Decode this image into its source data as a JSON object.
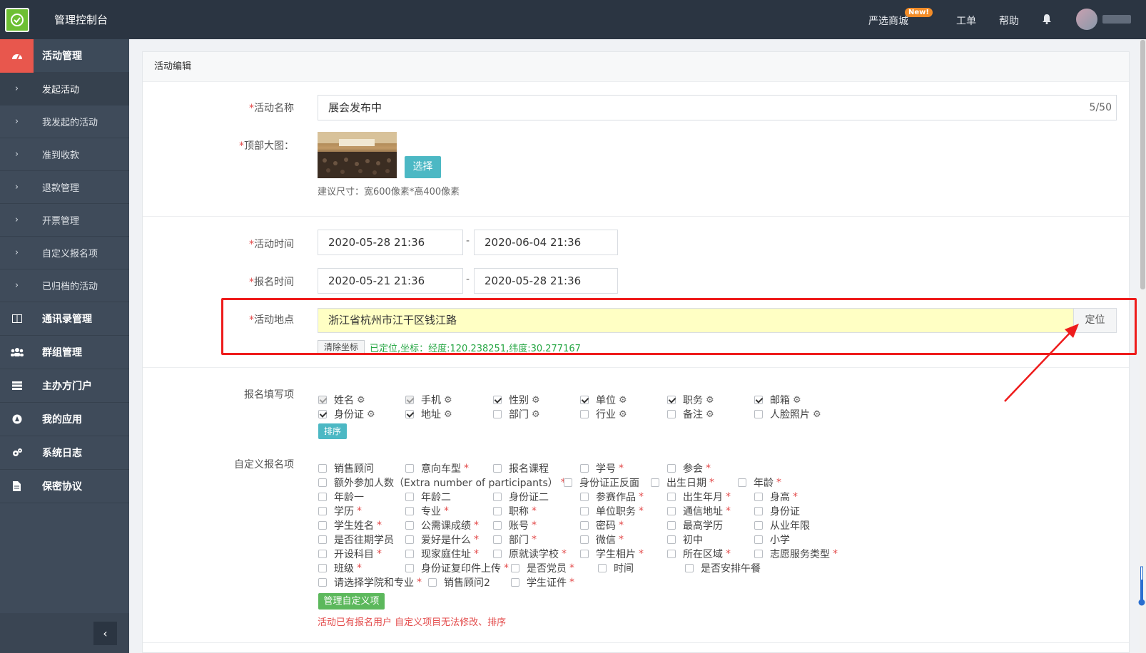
{
  "app": {
    "title": "管理控制台"
  },
  "topbar": {
    "links": [
      {
        "label": "严选商城"
      },
      {
        "label": "工单"
      },
      {
        "label": "帮助"
      }
    ],
    "new_badge": "New!"
  },
  "sidebar": {
    "sections": [
      {
        "label": "活动管理",
        "icon": "dashboard-icon",
        "active": true
      },
      {
        "label": "通讯录管理",
        "icon": "columns-icon"
      },
      {
        "label": "群组管理",
        "icon": "users-icon"
      },
      {
        "label": "主办方门户",
        "icon": "list-icon"
      },
      {
        "label": "我的应用",
        "icon": "app-icon"
      },
      {
        "label": "系统日志",
        "icon": "gears-icon"
      },
      {
        "label": "保密协议",
        "icon": "file-icon"
      }
    ],
    "sub_items": [
      {
        "label": "发起活动",
        "current": true
      },
      {
        "label": "我发起的活动"
      },
      {
        "label": "准到收款"
      },
      {
        "label": "退款管理"
      },
      {
        "label": "开票管理"
      },
      {
        "label": "自定义报名项"
      },
      {
        "label": "已归档的活动"
      }
    ],
    "collapse_label": "‹"
  },
  "panel": {
    "title": "活动编辑"
  },
  "form": {
    "name_label": "活动名称",
    "name_value": "展会发布中",
    "name_counter": "5/50",
    "image_label": "顶部大图：",
    "select_button": "选择",
    "image_hint": "建议尺寸：宽600像素*高400像素",
    "time_label": "活动时间",
    "time_start": "2020-05-28 21:36",
    "time_end": "2020-06-04 21:36",
    "signup_label": "报名时间",
    "signup_start": "2020-05-21 21:36",
    "signup_end": "2020-05-28 21:36",
    "dash": "-",
    "required_mark": "*",
    "location_label": "活动地点",
    "location_value": "浙江省杭州市江干区钱江路",
    "locate_button": "定位",
    "clear_button": "清除坐标",
    "located_text": "已定位,坐标：经度:120.238251,纬度:30.277167",
    "fields_label": "报名填写项",
    "sort_button": "排序",
    "custom_label": "自定义报名项",
    "manage_button": "管理自定义项",
    "warning": "活动已有报名用户 自定义项目无法修改、排序"
  },
  "signup_fields": [
    {
      "label": "姓名",
      "checked": true,
      "disabled": true
    },
    {
      "label": "手机",
      "checked": true,
      "disabled": true
    },
    {
      "label": "性别",
      "checked": true
    },
    {
      "label": "单位",
      "checked": true
    },
    {
      "label": "职务",
      "checked": true
    },
    {
      "label": "邮箱",
      "checked": true
    },
    {
      "label": "身份证",
      "checked": true
    },
    {
      "label": "地址",
      "checked": true
    },
    {
      "label": "部门",
      "checked": false
    },
    {
      "label": "行业",
      "checked": false
    },
    {
      "label": "备注",
      "checked": false
    },
    {
      "label": "人脸照片",
      "checked": false
    }
  ],
  "custom_fields": [
    [
      {
        "label": "销售顾问"
      },
      {
        "label": "意向车型",
        "req": true
      },
      {
        "label": "报名课程"
      },
      {
        "label": "学号",
        "req": true
      },
      {
        "label": "参会",
        "req": true
      }
    ],
    [
      {
        "label": "额外参加人数（Extra number of participants）",
        "req": true
      },
      {
        "label": "身份证正反面"
      },
      {
        "label": "出生日期",
        "req": true
      },
      {
        "label": "年龄",
        "req": true
      }
    ],
    [
      {
        "label": "年龄一"
      },
      {
        "label": "年龄二"
      },
      {
        "label": "身份证二"
      },
      {
        "label": "参赛作品",
        "req": true
      },
      {
        "label": "出生年月",
        "req": true
      },
      {
        "label": "身高",
        "req": true
      }
    ],
    [
      {
        "label": "学历",
        "req": true
      },
      {
        "label": "专业",
        "req": true
      },
      {
        "label": "职称",
        "req": true
      },
      {
        "label": "单位职务",
        "req": true
      },
      {
        "label": "通信地址",
        "req": true
      },
      {
        "label": "身份证"
      }
    ],
    [
      {
        "label": "学生姓名",
        "req": true
      },
      {
        "label": "公需课成绩",
        "req": true
      },
      {
        "label": "账号",
        "req": true
      },
      {
        "label": "密码",
        "req": true
      },
      {
        "label": "最高学历"
      },
      {
        "label": "从业年限"
      }
    ],
    [
      {
        "label": "是否往期学员"
      },
      {
        "label": "爱好是什么",
        "req": true
      },
      {
        "label": "部门",
        "req": true
      },
      {
        "label": "微信",
        "req": true
      },
      {
        "label": "初中"
      },
      {
        "label": "小学"
      }
    ],
    [
      {
        "label": "开设科目",
        "req": true
      },
      {
        "label": "现家庭住址",
        "req": true
      },
      {
        "label": "原就读学校",
        "req": true
      },
      {
        "label": "学生相片",
        "req": true
      },
      {
        "label": "所在区域",
        "req": true
      },
      {
        "label": "志愿服务类型",
        "req": true
      }
    ],
    [
      {
        "label": "班级",
        "req": true
      },
      {
        "label": "身份证复印件上传",
        "req": true
      },
      {
        "label": "是否党员",
        "req": true
      },
      {
        "label": "时间"
      },
      {
        "label": "是否安排午餐"
      }
    ],
    [
      {
        "label": "请选择学院和专业",
        "req": true
      },
      {
        "label": "销售顾问2"
      },
      {
        "label": "学生证件",
        "req": true
      }
    ]
  ]
}
